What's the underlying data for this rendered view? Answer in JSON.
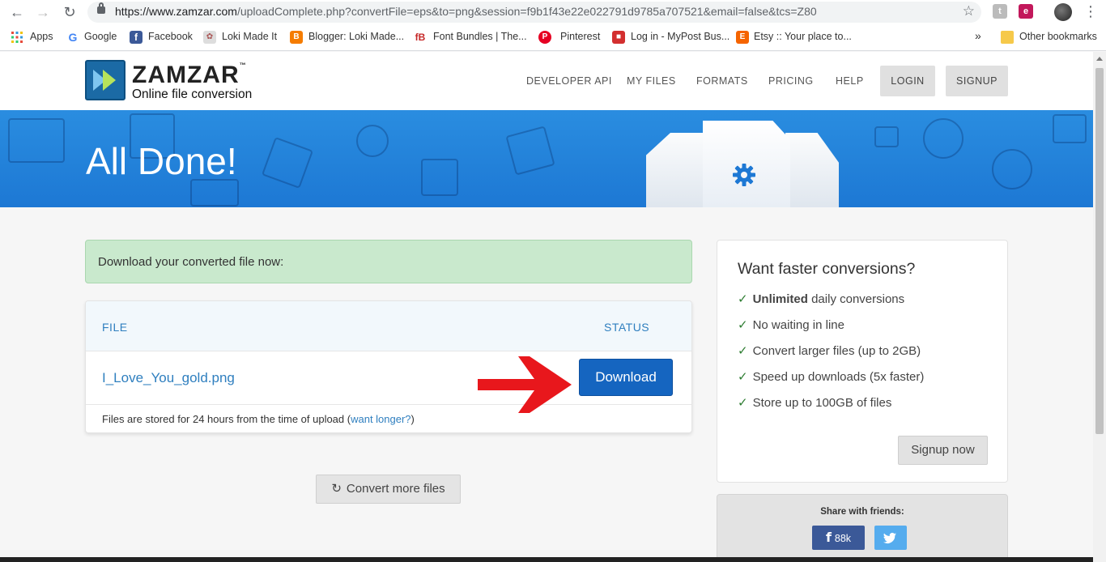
{
  "browser": {
    "url_host": "https://www.zamzar.com",
    "url_path": "/uploadComplete.php?convertFile=eps&to=png&session=f9b1f43e22e022791d9785a707521&email=false&tcs=Z80",
    "bookmarks": [
      {
        "label": "Apps",
        "icon": "apps-grid-icon"
      },
      {
        "label": "Google",
        "icon": "google-icon"
      },
      {
        "label": "Facebook",
        "icon": "facebook-icon"
      },
      {
        "label": "Loki Made It",
        "icon": "loki-icon"
      },
      {
        "label": "Blogger: Loki Made...",
        "icon": "blogger-icon"
      },
      {
        "label": "Font Bundles | The...",
        "icon": "fontbundles-icon"
      },
      {
        "label": "Pinterest",
        "icon": "pinterest-icon"
      },
      {
        "label": "Log in - MyPost Bus...",
        "icon": "mypost-icon"
      },
      {
        "label": "Etsy :: Your place to...",
        "icon": "etsy-icon"
      }
    ],
    "overflow": "»",
    "other_bookmarks": "Other bookmarks"
  },
  "header": {
    "logo_title": "ZAMZAR",
    "logo_tm": "™",
    "logo_subtitle": "Online file conversion",
    "nav": [
      "DEVELOPER API",
      "MY FILES",
      "FORMATS",
      "PRICING",
      "HELP"
    ],
    "login": "LOGIN",
    "signup": "SIGNUP"
  },
  "banner": {
    "title": "All Done!"
  },
  "main": {
    "alert": "Download your converted file now:",
    "col_file": "FILE",
    "col_status": "STATUS",
    "filename": "I_Love_You_gold.png",
    "download": "Download",
    "footer_text": "Files are stored for 24 hours from the time of upload (",
    "footer_link": "want longer?",
    "footer_close": ")",
    "convert_more": "Convert more files"
  },
  "panel": {
    "title": "Want faster conversions?",
    "features": [
      {
        "bold": "Unlimited",
        "text": " daily conversions"
      },
      {
        "bold": "",
        "text": "No waiting in line"
      },
      {
        "bold": "",
        "text": "Convert larger files (up to 2GB)"
      },
      {
        "bold": "",
        "text": "Speed up downloads (5x faster)"
      },
      {
        "bold": "",
        "text": "Store up to 100GB of files"
      }
    ],
    "signup_now": "Signup now",
    "share_label": "Share with friends:",
    "fb_count": "88k"
  },
  "colors": {
    "brand_blue": "#1d78d4",
    "download_blue": "#1565c0",
    "alert_green": "#c9e9cd",
    "arrow_red": "#e8171c",
    "check_green": "#2e7d32"
  }
}
